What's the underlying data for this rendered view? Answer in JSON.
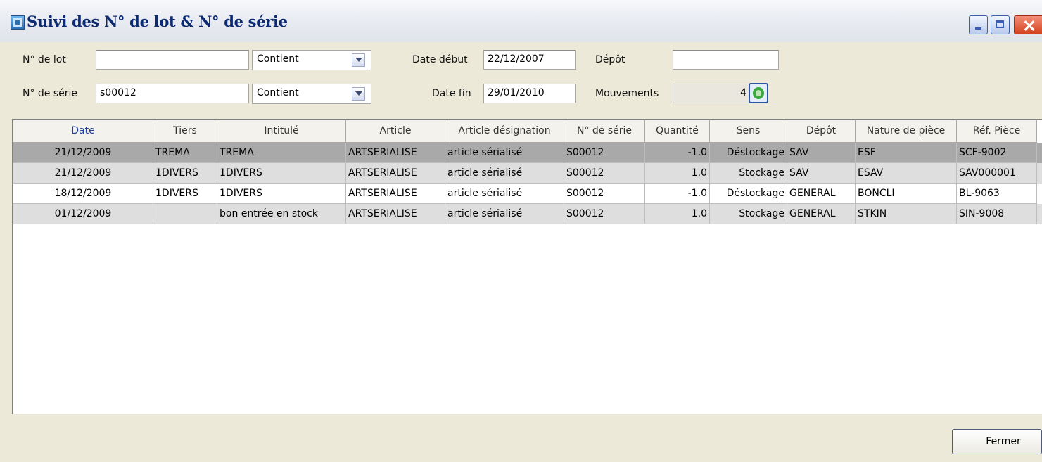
{
  "window": {
    "title": "Suivi des N° de lot & N° de série",
    "controls": {
      "minimize": "minimize-icon",
      "maximize": "maximize-icon",
      "close": "close-icon"
    }
  },
  "filters": {
    "lot_label": "N° de lot",
    "lot_value": "",
    "lot_mode": "Contient",
    "serie_label": "N° de série",
    "serie_value": "s00012",
    "serie_mode": "Contient",
    "date_debut_label": "Date début",
    "date_debut_value": "22/12/2007",
    "date_fin_label": "Date fin",
    "date_fin_value": "29/01/2010",
    "depot_label": "Dépôt",
    "depot_value": "",
    "mouvements_label": "Mouvements",
    "mouvements_value": "4",
    "refresh_icon": "refresh-icon"
  },
  "table": {
    "columns": [
      "Date",
      "Tiers",
      "Intitulé",
      "Article",
      "Article désignation",
      "N° de série",
      "Quantité",
      "Sens",
      "Dépôt",
      "Nature de pièce",
      "Réf. Pièce"
    ],
    "rows": [
      [
        "21/12/2009",
        "TREMA",
        "TREMA",
        "ARTSERIALISE",
        "article sérialisé",
        "S00012",
        "-1.0",
        "Déstockage",
        "SAV",
        "ESF",
        "SCF-9002"
      ],
      [
        "21/12/2009",
        "1DIVERS",
        "1DIVERS",
        "ARTSERIALISE",
        "article sérialisé",
        "S00012",
        "1.0",
        "Stockage",
        "SAV",
        "ESAV",
        "SAV000001"
      ],
      [
        "18/12/2009",
        "1DIVERS",
        "1DIVERS",
        "ARTSERIALISE",
        "article sérialisé",
        "S00012",
        "-1.0",
        "Déstockage",
        "GENERAL",
        "BONCLI",
        "BL-9063"
      ],
      [
        "01/12/2009",
        "",
        "bon entrée en stock",
        "ARTSERIALISE",
        "article sérialisé",
        "S00012",
        "1.0",
        "Stockage",
        "GENERAL",
        "STKIN",
        "SIN-9008"
      ]
    ],
    "row_colors": [
      "#a9a9a9",
      "#dedede",
      "#ffffff",
      "#dedede"
    ]
  },
  "footer": {
    "close_label": "Fermer"
  }
}
